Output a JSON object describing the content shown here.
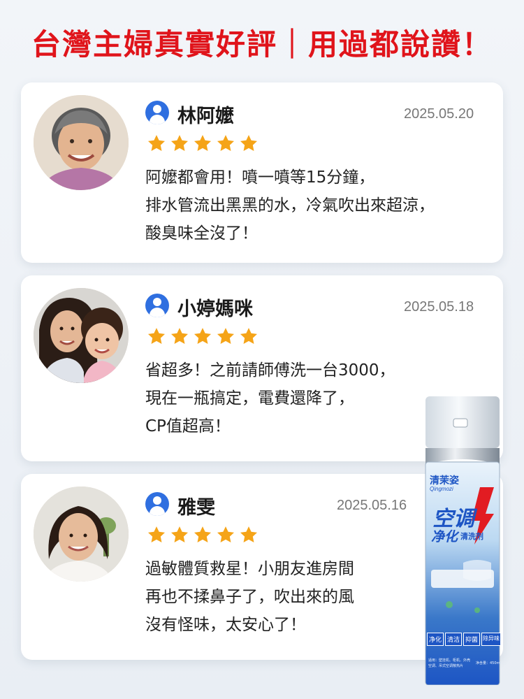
{
  "headline": "台灣主婦真實好評｜用過都說讚！",
  "reviews": [
    {
      "name": "林阿嬤",
      "date": "2025.05.20",
      "rating": 5,
      "lines": [
        "阿嬤都會用！噴一噴等15分鐘，",
        "排水管流出黑黑的水，冷氣吹出來超涼，",
        "酸臭味全沒了！"
      ]
    },
    {
      "name": "小婷媽咪",
      "date": "2025.05.18",
      "rating": 5,
      "lines": [
        "省超多！之前請師傅洗一台3000，",
        "現在一瓶搞定，電費還降了，",
        "CP值超高！"
      ]
    },
    {
      "name": "雅雯",
      "date": "2025.05.16",
      "rating": 5,
      "lines": [
        "過敏體質救星！小朋友進房間",
        "再也不揉鼻子了，吹出來的風",
        "沒有怪味，太安心了！"
      ]
    }
  ],
  "product": {
    "brand": "清茉姿",
    "brand_latin": "Qingmozi",
    "title_line1": "空调",
    "title_line2": "净化",
    "title_suffix": "清洗剂",
    "tags": [
      "净化",
      "清洁",
      "抑菌",
      "除异味"
    ],
    "fine_print_1": "适用：壁挂机、柜机、外壳",
    "fine_print_2": "空调、吊式空调散热片",
    "volume": "净含量：450ml"
  },
  "colors": {
    "headline": "#e0141b",
    "star": "#f5a418",
    "user_icon": "#2f6fe0",
    "product_blue": "#1d55c4",
    "product_red": "#e21c22"
  }
}
